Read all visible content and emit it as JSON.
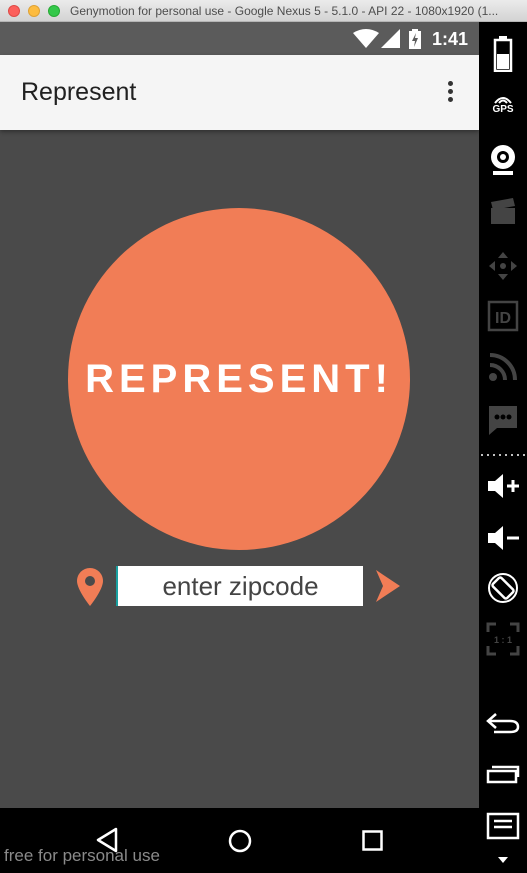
{
  "window": {
    "title": "Genymotion for personal use - Google Nexus 5 - 5.1.0 - API 22 - 1080x1920 (1..."
  },
  "statusbar": {
    "time": "1:41",
    "icons": [
      "wifi-icon",
      "signal-icon",
      "battery-charging-icon"
    ]
  },
  "appbar": {
    "title": "Represent",
    "menu_icon": "more-vert-icon"
  },
  "main": {
    "logo_text": "REPRESENT!",
    "zip_placeholder": "enter zipcode",
    "location_icon": "location-pin-icon",
    "submit_icon": "chevron-right-icon"
  },
  "navbar": {
    "buttons": [
      "back-icon",
      "home-icon",
      "recents-icon"
    ]
  },
  "watermark": "free for personal use",
  "sidebar": {
    "gps_label": "GPS",
    "id_label": "ID",
    "pixel_perfect_label": "1 : 1",
    "buttons": [
      "battery-icon",
      "gps-icon",
      "webcam-icon",
      "screencast-icon",
      "remote-control-icon",
      "identifiers-icon",
      "network-icon",
      "sms-icon",
      "volume-up-icon",
      "volume-down-icon",
      "rotate-icon",
      "pixel-perfect-icon",
      "back-icon",
      "recent-apps-icon",
      "menu-icon"
    ]
  },
  "colors": {
    "accent": "#f17d56",
    "background": "#4a4a4a",
    "appbar": "#f5f5f5",
    "statusbar": "#5b5b5b",
    "cursor": "#19a0a0"
  }
}
